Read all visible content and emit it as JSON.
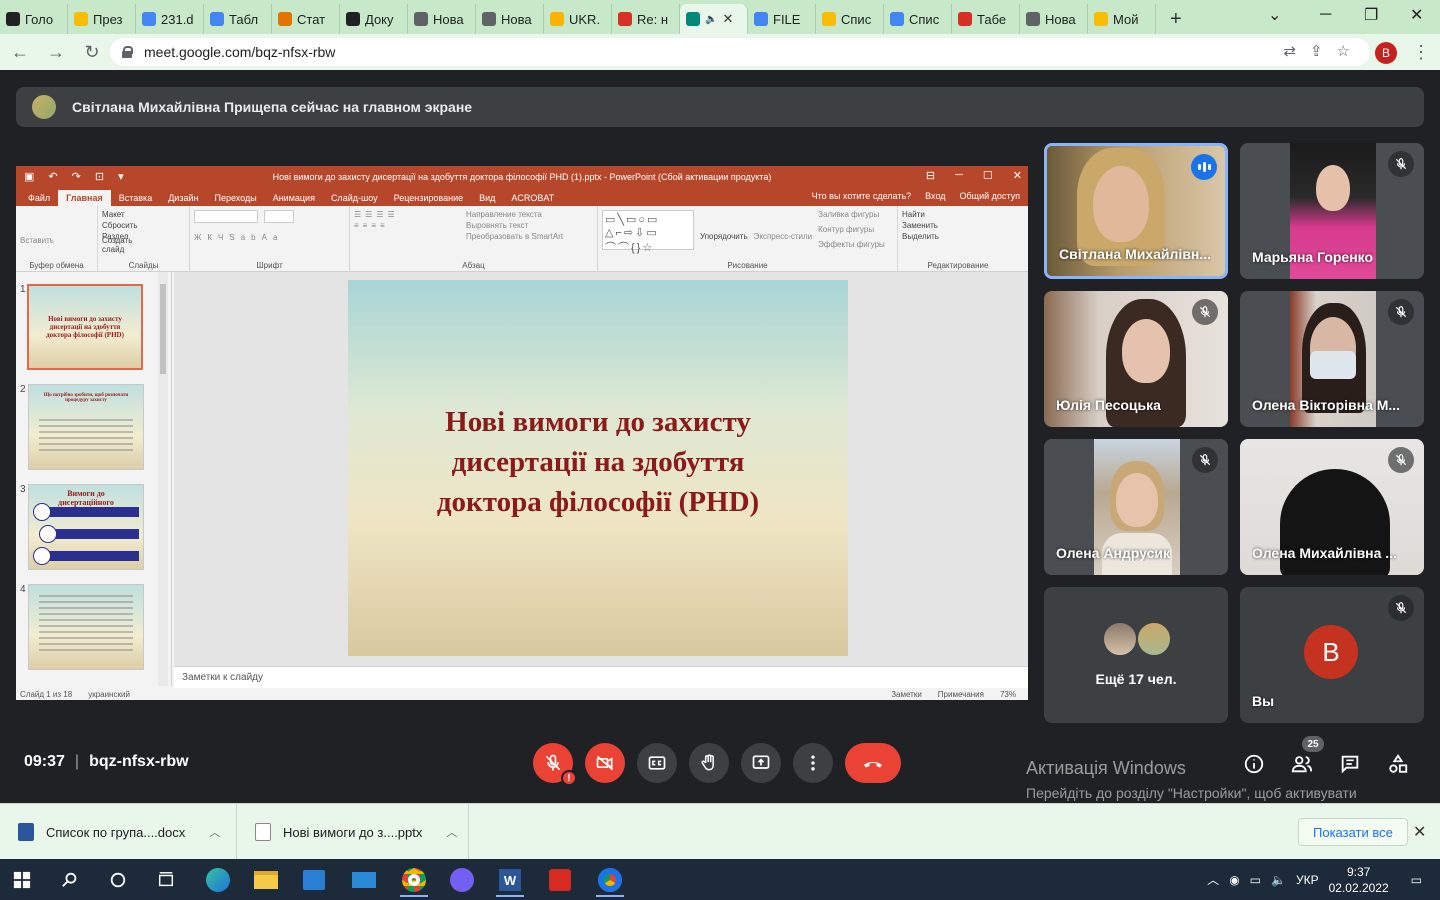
{
  "browser": {
    "tabs": [
      {
        "label": "Голо",
        "icon": "classroom-icon",
        "color": "#202124"
      },
      {
        "label": "През",
        "icon": "drive-icon",
        "color": "#fbbc04"
      },
      {
        "label": "231.d",
        "icon": "docs-icon",
        "color": "#4285f4"
      },
      {
        "label": "Табл",
        "icon": "docs-icon",
        "color": "#4285f4"
      },
      {
        "label": "Стат",
        "icon": "article-icon",
        "color": "#e37400"
      },
      {
        "label": "Доку",
        "icon": "classroom-icon",
        "color": "#202124"
      },
      {
        "label": "Нова",
        "icon": "chrome-icon",
        "color": "#5f6368"
      },
      {
        "label": "Нова",
        "icon": "chrome-icon",
        "color": "#5f6368"
      },
      {
        "label": "UKR.",
        "icon": "ukr-icon",
        "color": "#ffb300"
      },
      {
        "label": "Re: н",
        "icon": "mail-icon",
        "color": "#d93025"
      },
      {
        "label": "",
        "icon": "meet-icon",
        "color": "#00897b",
        "active": true
      },
      {
        "label": "FILE",
        "icon": "docs-icon",
        "color": "#4285f4"
      },
      {
        "label": "Спис",
        "icon": "drive-icon",
        "color": "#fbbc04"
      },
      {
        "label": "Спис",
        "icon": "docs-icon",
        "color": "#4285f4"
      },
      {
        "label": "Табе",
        "icon": "gmail-icon",
        "color": "#d93025"
      },
      {
        "label": "Нова",
        "icon": "chrome-icon",
        "color": "#5f6368"
      },
      {
        "label": "Мой",
        "icon": "drive-icon",
        "color": "#fbbc04"
      }
    ],
    "url": "meet.google.com/bqz-nfsx-rbw",
    "profile_initial": "B"
  },
  "meet": {
    "banner": "Світлана Михайлівна Прищепа сейчас на главном экране",
    "time": "09:37",
    "meeting_code": "bqz-nfsx-rbw",
    "participant_count": "25",
    "participants": [
      {
        "name": "Світлана Михайлівн...",
        "speaking": true
      },
      {
        "name": "Марьяна Горенко"
      },
      {
        "name": "Юлія Песоцька"
      },
      {
        "name": "Олена Вікторівна М..."
      },
      {
        "name": "Олена Андрусик"
      },
      {
        "name": "Олена Михайлівна ..."
      }
    ],
    "more_label": "Ещё 17 чел.",
    "you_label": "Вы",
    "you_initial": "B",
    "activation_title": "Активація Windows",
    "activation_text": "Перейдіть до розділу \"Настройки\", щоб активувати Windows."
  },
  "ppt": {
    "title": "Нові вимоги до захисту дисертації на здобуття доктора філософії PHD   (1).pptx - PowerPoint (Сбой активации продукта)",
    "tabs": [
      "Файл",
      "Главная",
      "Вставка",
      "Дизайн",
      "Переходы",
      "Анимация",
      "Слайд-шоу",
      "Рецензирование",
      "Вид",
      "ACROBAT"
    ],
    "tell_me": "Что вы хотите сделать?",
    "sign_in": "Вход",
    "share": "Общий доступ",
    "ribbon": {
      "clipboard": {
        "paste": "Вставить",
        "name": "Буфер обмена"
      },
      "slides": {
        "new": "Создать слайд",
        "layout": "Макет",
        "reset": "Сбросить",
        "section": "Раздел",
        "name": "Слайды"
      },
      "font": {
        "name": "Шрифт"
      },
      "paragraph": {
        "direction": "Направление текста",
        "align": "Выровнять текст",
        "smartart": "Преобразовать в SmartArt",
        "name": "Абзац"
      },
      "drawing": {
        "arrange": "Упорядочить",
        "styles": "Экспресс-стили",
        "fill": "Заливка фигуры",
        "outline": "Контур фигуры",
        "effects": "Эффекты фигуры",
        "name": "Рисование"
      },
      "editing": {
        "find": "Найти",
        "replace": "Заменить",
        "select": "Выделить",
        "name": "Редактирование"
      }
    },
    "thumbs": [
      {
        "num": "1",
        "title": "Нові вимоги до захисту дисертації на здобуття доктора філософії (PHD)"
      },
      {
        "num": "2",
        "title": "Що потрібно зробити, щоб розпочати процедуру захисту"
      },
      {
        "num": "3",
        "title": "Вимоги до дисертаційного дослідження"
      },
      {
        "num": "4",
        "title": ""
      }
    ],
    "slide_title": "Нові вимоги до захисту дисертації на здобуття доктора філософії (PHD)",
    "notes_placeholder": "Заметки к слайду",
    "status": {
      "slide": "Слайд 1 из 18",
      "lang": "украинский",
      "notes": "Заметки",
      "comments": "Примечания",
      "zoom": "73%"
    }
  },
  "downloads": {
    "items": [
      {
        "name": "Список по група....docx",
        "color": "#2b579a"
      },
      {
        "name": "Нові вимоги до з....pptx",
        "color": "#ffffff"
      }
    ],
    "show_all": "Показати все"
  },
  "taskbar": {
    "lang": "УКР",
    "time": "9:37",
    "date": "02.02.2022"
  }
}
